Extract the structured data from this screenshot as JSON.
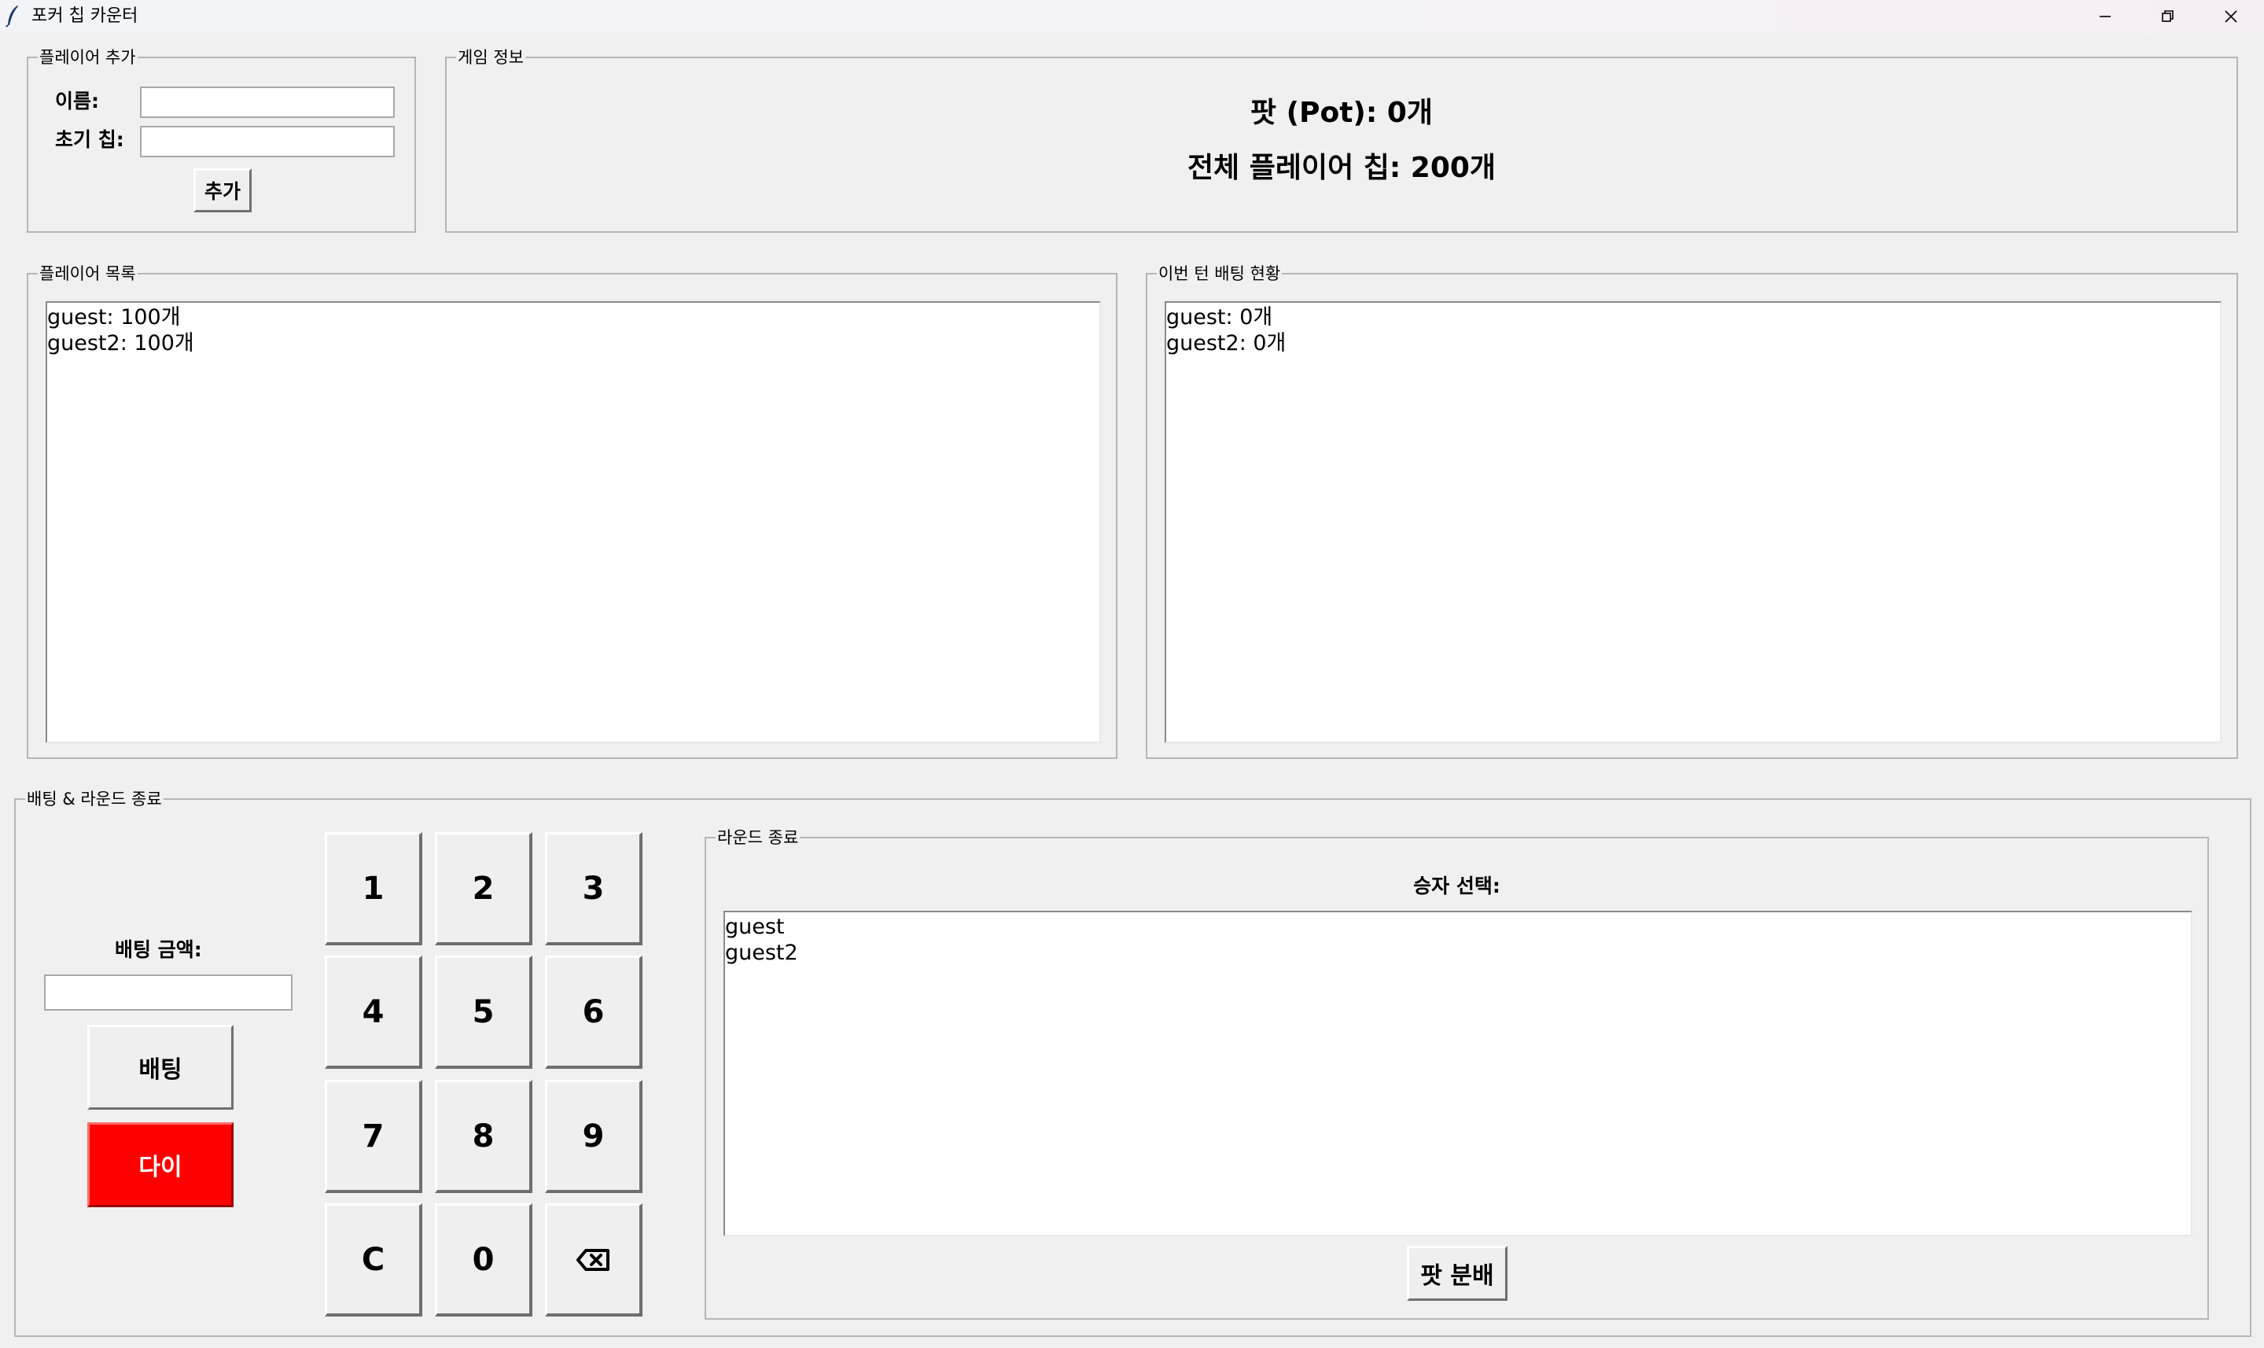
{
  "window": {
    "title": "포커 칩 카운터"
  },
  "add_player": {
    "legend": "플레이어 추가",
    "name_label": "이름:",
    "chips_label": "초기 칩:",
    "name_value": "",
    "chips_value": "",
    "add_button": "추가"
  },
  "game_info": {
    "legend": "게임 정보",
    "pot_text": "팟 (Pot): 0개",
    "total_text": "전체 플레이어 칩: 200개"
  },
  "player_list": {
    "legend": "플레이어 목록",
    "items": [
      "guest: 100개",
      "guest2: 100개"
    ]
  },
  "bet_status": {
    "legend": "이번 턴 배팅 현황",
    "items": [
      "guest: 0개",
      "guest2: 0개"
    ]
  },
  "betting": {
    "legend": "배팅 & 라운드 종료",
    "amount_label": "배팅 금액:",
    "amount_value": "",
    "bet_button": "배팅",
    "die_button": "다이",
    "die_color": "#ff0000",
    "keypad": [
      "1",
      "2",
      "3",
      "4",
      "5",
      "6",
      "7",
      "8",
      "9",
      "C",
      "0",
      "⌫"
    ]
  },
  "round_end": {
    "legend": "라운드 종료",
    "winner_label": "승자 선택:",
    "winners": [
      "guest",
      "guest2"
    ],
    "distribute_button": "팟 분배"
  }
}
